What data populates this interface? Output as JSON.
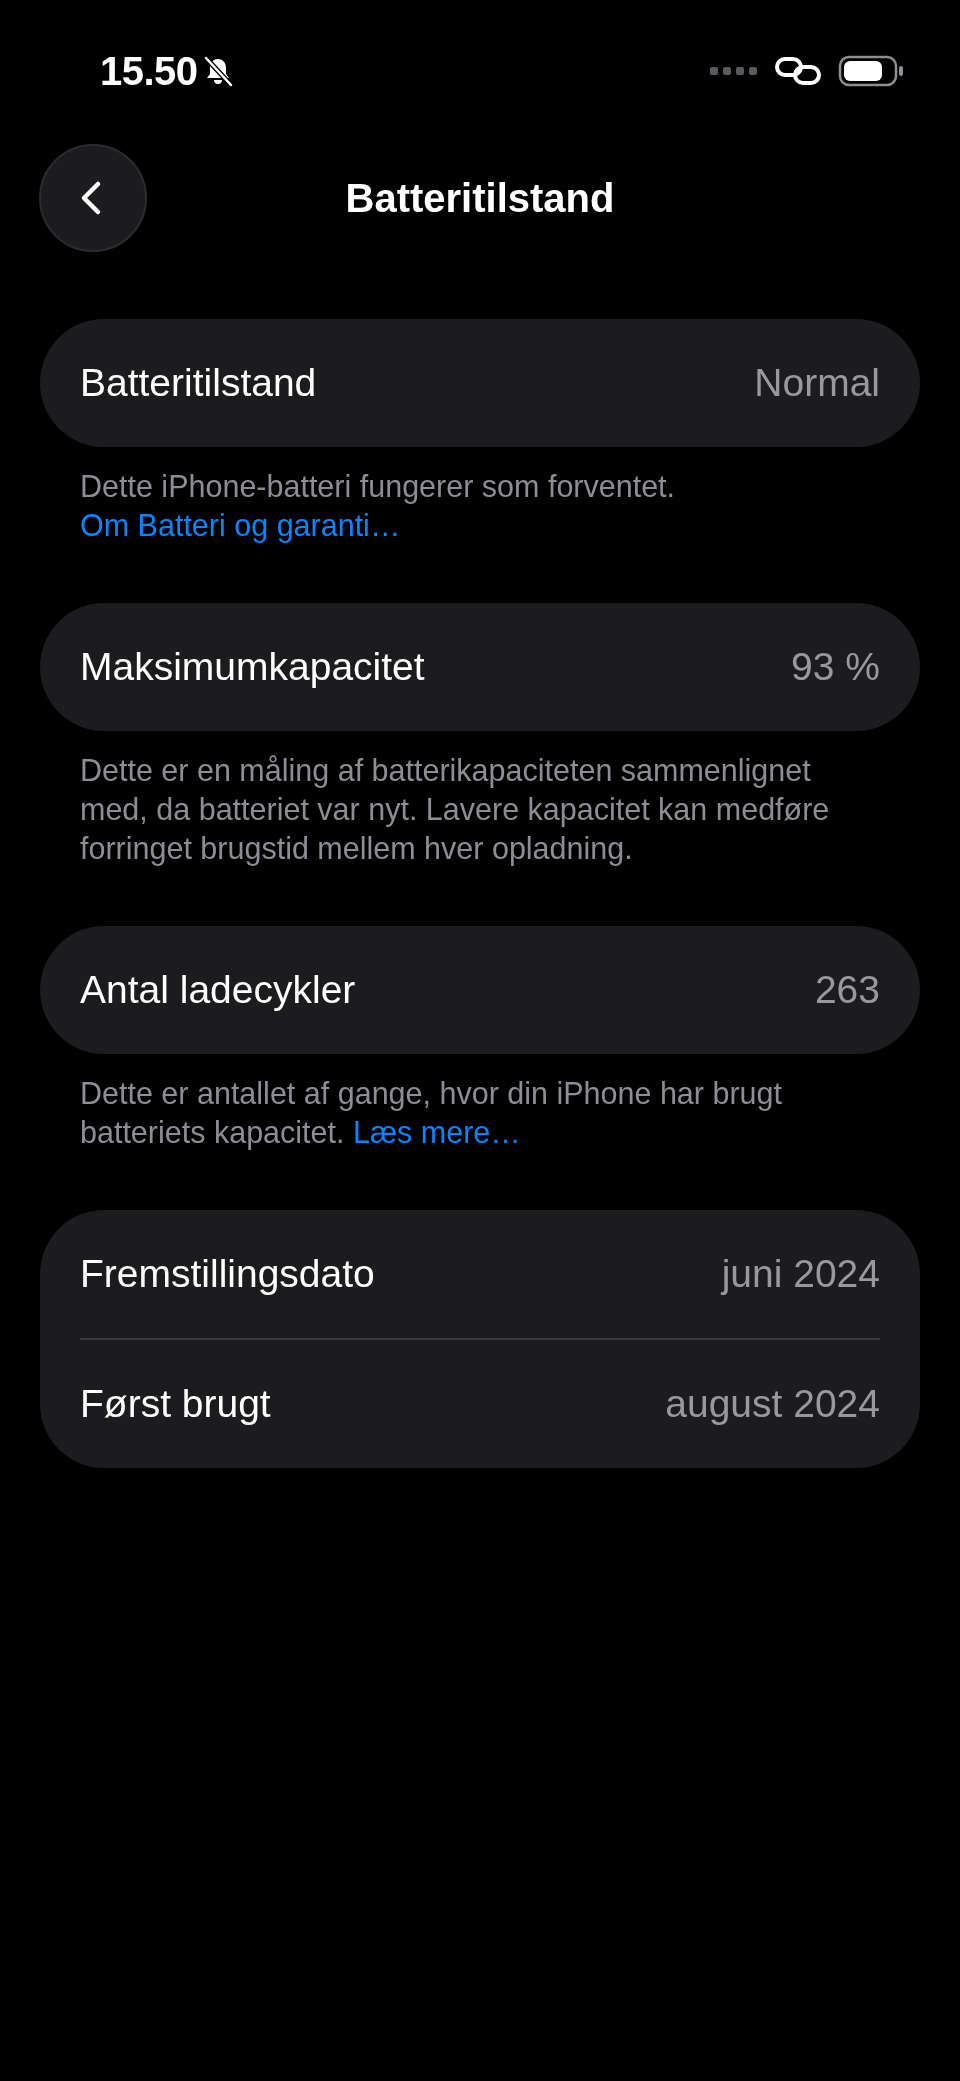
{
  "status_bar": {
    "time": "15.50"
  },
  "header": {
    "title": "Batteritilstand"
  },
  "sections": [
    {
      "rows": [
        {
          "label": "Batteritilstand",
          "value": "Normal"
        }
      ],
      "footer": {
        "text": "Dette iPhone-batteri fungerer som forventet.",
        "link": "Om Batteri og garanti…"
      }
    },
    {
      "rows": [
        {
          "label": "Maksimumkapacitet",
          "value": "93 %"
        }
      ],
      "footer": {
        "text": "Dette er en måling af batterikapaciteten sammenlignet med, da batteriet var nyt. Lavere kapacitet kan medføre forringet brugstid mellem hver opladning."
      }
    },
    {
      "rows": [
        {
          "label": "Antal ladecykler",
          "value": "263"
        }
      ],
      "footer": {
        "text": "Dette er antallet af gange, hvor din iPhone har brugt batteriets kapacitet.",
        "link": "Læs mere…"
      }
    },
    {
      "rows": [
        {
          "label": "Fremstillingsdato",
          "value": "juni 2024"
        },
        {
          "label": "Først brugt",
          "value": "august 2024"
        }
      ]
    }
  ]
}
